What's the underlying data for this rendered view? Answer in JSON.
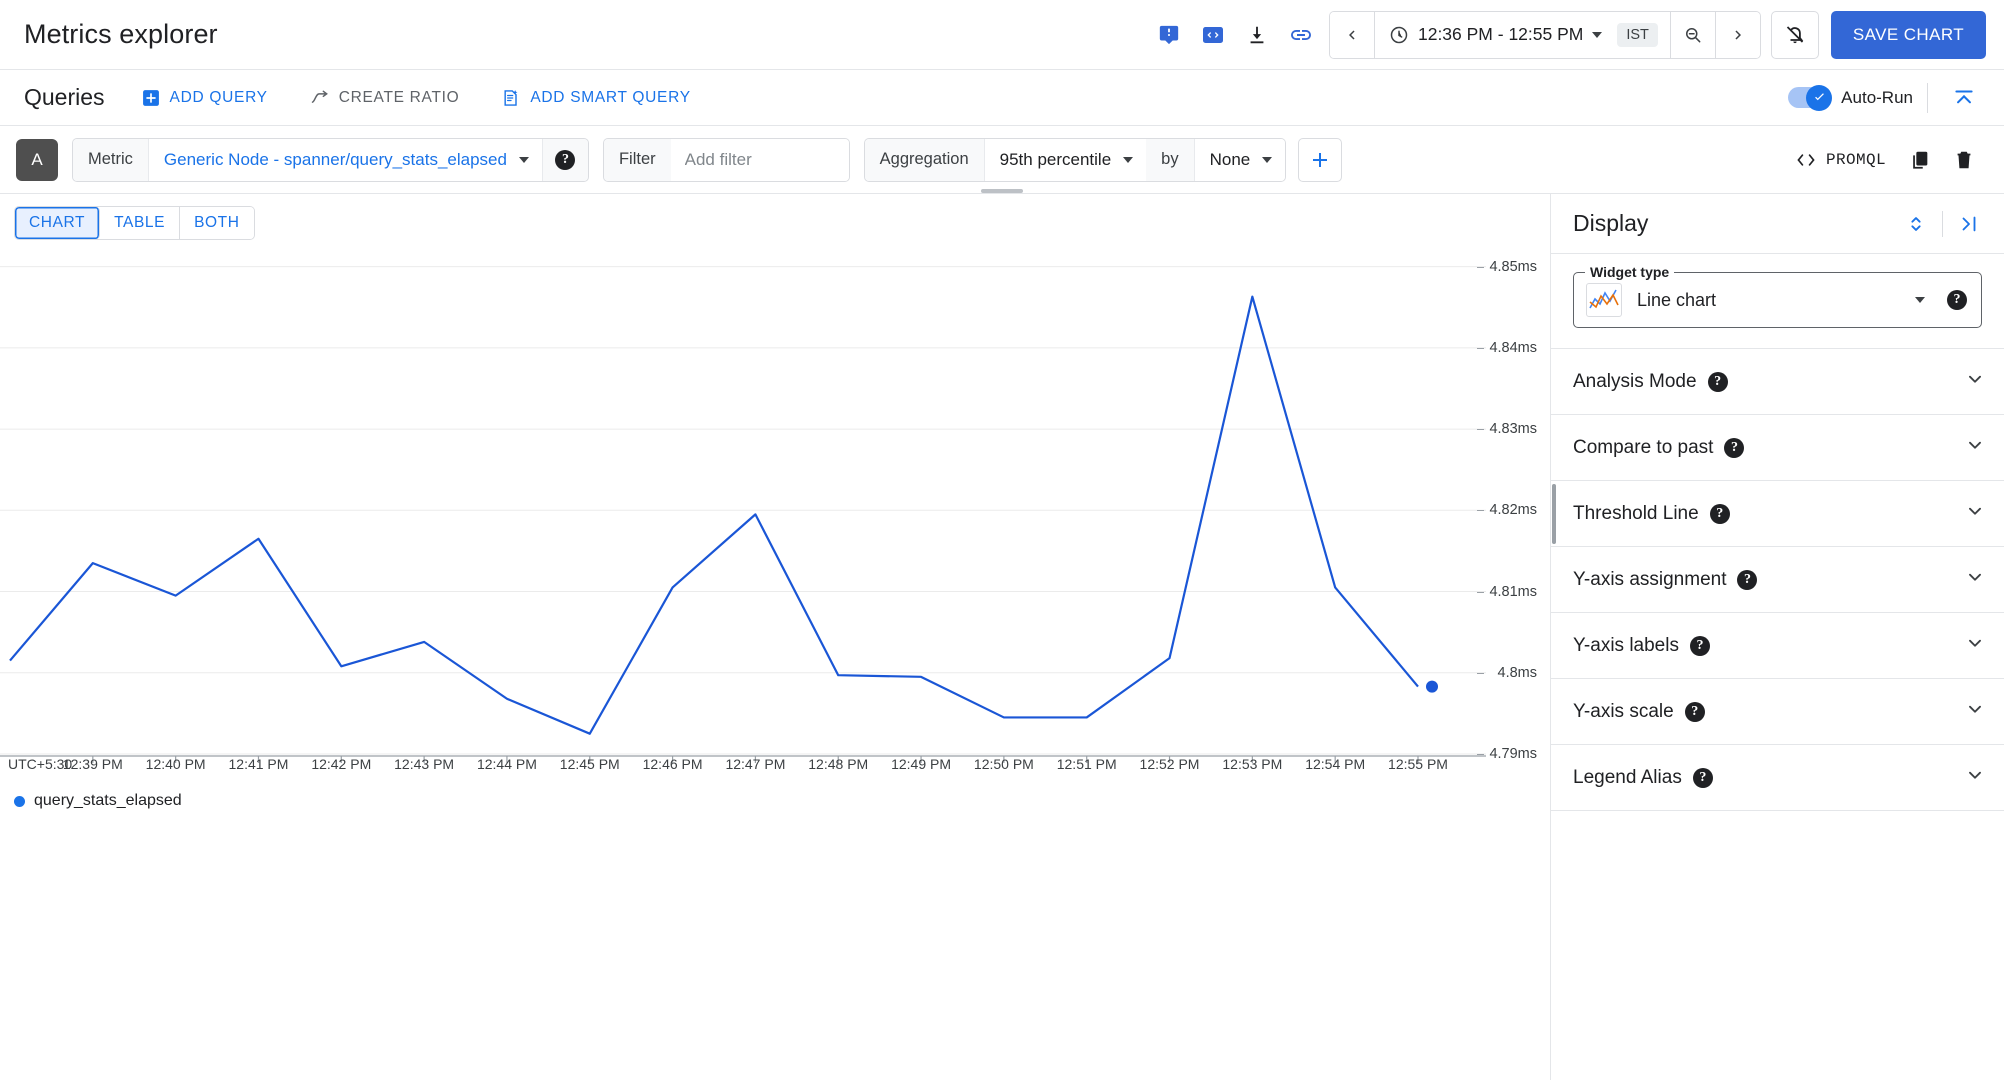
{
  "header": {
    "title": "Metrics explorer",
    "icons": [
      {
        "name": "feedback-icon"
      },
      {
        "name": "code-icon"
      },
      {
        "name": "download-icon"
      },
      {
        "name": "link-icon"
      }
    ],
    "prev_label": "‹",
    "next_label": "›",
    "time_range": "12:36 PM - 12:55 PM",
    "timezone": "IST",
    "save_chart_label": "SAVE CHART"
  },
  "queries": {
    "title": "Queries",
    "add_query_label": "ADD QUERY",
    "create_ratio_label": "CREATE RATIO",
    "add_smart_query_label": "ADD SMART QUERY",
    "auto_run_label": "Auto-Run",
    "auto_run_on": true
  },
  "query_row": {
    "chip": "A",
    "metric_label": "Metric",
    "metric_value": "Generic Node - spanner/query_stats_elapsed",
    "filter_label": "Filter",
    "filter_placeholder": "Add filter",
    "filter_value": "",
    "aggregation_label": "Aggregation",
    "aggregation_value": "95th percentile",
    "by_label": "by",
    "group_by_value": "None",
    "promql_label": "PROMQL"
  },
  "view_tabs": [
    {
      "label": "CHART",
      "active": true
    },
    {
      "label": "TABLE",
      "active": false
    },
    {
      "label": "BOTH",
      "active": false
    }
  ],
  "display": {
    "title": "Display",
    "widget_type_legend": "Widget type",
    "widget_type_value": "Line chart",
    "sections": [
      {
        "label": "Analysis Mode"
      },
      {
        "label": "Compare to past"
      },
      {
        "label": "Threshold Line"
      },
      {
        "label": "Y-axis assignment"
      },
      {
        "label": "Y-axis labels"
      },
      {
        "label": "Y-axis scale"
      },
      {
        "label": "Legend Alias"
      }
    ]
  },
  "colors": {
    "accent": "#1a73e8",
    "primary_button": "#3367d6",
    "line": "#1a56d6",
    "grid": "#ebebeb",
    "text": "#202124"
  },
  "chart_data": {
    "type": "line",
    "title": "",
    "xlabel": "",
    "ylabel": "",
    "timezone_label": "UTC+5:30",
    "legend": [
      "query_stats_elapsed"
    ],
    "legend_position": "bottom-left",
    "grid": true,
    "ylim": [
      4.79,
      4.855
    ],
    "yticks": [
      4.85,
      4.84,
      4.83,
      4.82,
      4.81,
      4.8,
      4.79
    ],
    "ytick_labels": [
      "4.85ms",
      "4.84ms",
      "4.83ms",
      "4.82ms",
      "4.81ms",
      "4.8ms",
      "4.79ms"
    ],
    "y_unit": "ms",
    "xticks": [
      "12:39 PM",
      "12:40 PM",
      "12:41 PM",
      "12:42 PM",
      "12:43 PM",
      "12:44 PM",
      "12:45 PM",
      "12:46 PM",
      "12:47 PM",
      "12:48 PM",
      "12:49 PM",
      "12:50 PM",
      "12:51 PM",
      "12:52 PM",
      "12:53 PM",
      "12:54 PM",
      "12:55 PM"
    ],
    "x": [
      "12:38 PM",
      "12:39 PM",
      "12:40 PM",
      "12:41 PM",
      "12:42 PM",
      "12:43 PM",
      "12:44 PM",
      "12:45 PM",
      "12:46 PM",
      "12:47 PM",
      "12:48 PM",
      "12:49 PM",
      "12:50 PM",
      "12:51 PM",
      "12:52 PM",
      "12:53 PM",
      "12:54 PM",
      "12:55 PM"
    ],
    "series": [
      {
        "name": "query_stats_elapsed",
        "color": "#1a56d6",
        "values": [
          4.8015,
          4.8135,
          4.8095,
          4.8165,
          4.8008,
          4.8038,
          4.7968,
          4.7925,
          4.8105,
          4.8195,
          4.7997,
          4.7995,
          4.7945,
          4.7945,
          4.8018,
          4.8463,
          4.8105,
          4.7983
        ]
      }
    ],
    "end_marker": {
      "x": "12:55 PM",
      "y": 4.7983
    }
  }
}
